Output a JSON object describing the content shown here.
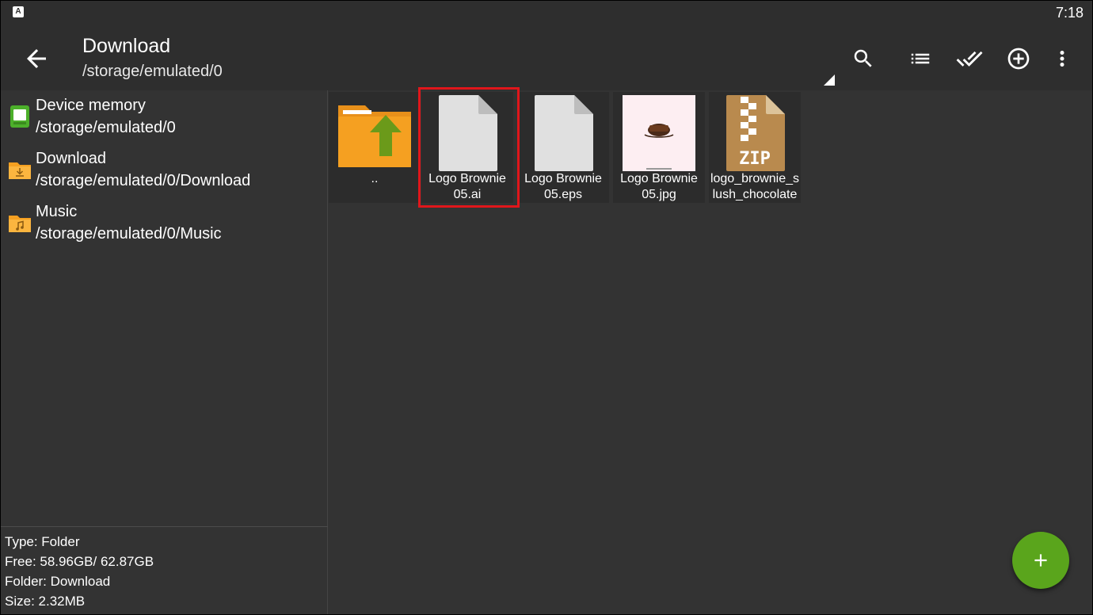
{
  "status_bar": {
    "notification_icon": "A",
    "time": "7:18"
  },
  "app_bar": {
    "title": "Download",
    "subtitle": "/storage/emulated/0",
    "icons": [
      "back-arrow-icon",
      "search-icon",
      "list-view-icon",
      "select-all-icon",
      "add-circle-icon",
      "more-vert-icon"
    ]
  },
  "sidebar": {
    "items": [
      {
        "name": "Device memory",
        "path": "/storage/emulated/0",
        "icon": "device-memory-icon"
      },
      {
        "name": "Download",
        "path": "/storage/emulated/0/Download",
        "icon": "download-folder-icon"
      },
      {
        "name": "Music",
        "path": "/storage/emulated/0/Music",
        "icon": "music-folder-icon"
      }
    ],
    "info": {
      "type": "Type: Folder",
      "free": "Free: 58.96GB/ 62.87GB",
      "folder": "Folder: Download",
      "size": "Size: 2.32MB"
    }
  },
  "files": [
    {
      "line1": "..",
      "line2": "",
      "kind": "parent-folder"
    },
    {
      "line1": "Logo Brownie",
      "line2": "05.ai",
      "kind": "document",
      "selected": true
    },
    {
      "line1": "Logo Brownie",
      "line2": "05.eps",
      "kind": "document"
    },
    {
      "line1": "Logo Brownie",
      "line2": "05.jpg",
      "kind": "image"
    },
    {
      "line1": "logo_brownie_s",
      "line2": "lush_chocolate",
      "kind": "zip"
    }
  ],
  "zip_badge": "ZIP",
  "colors": {
    "background": "#333333",
    "bar": "#2e2e2e",
    "fab": "#5aa51c",
    "highlight": "#e0161b",
    "folder": "#f5a021"
  }
}
